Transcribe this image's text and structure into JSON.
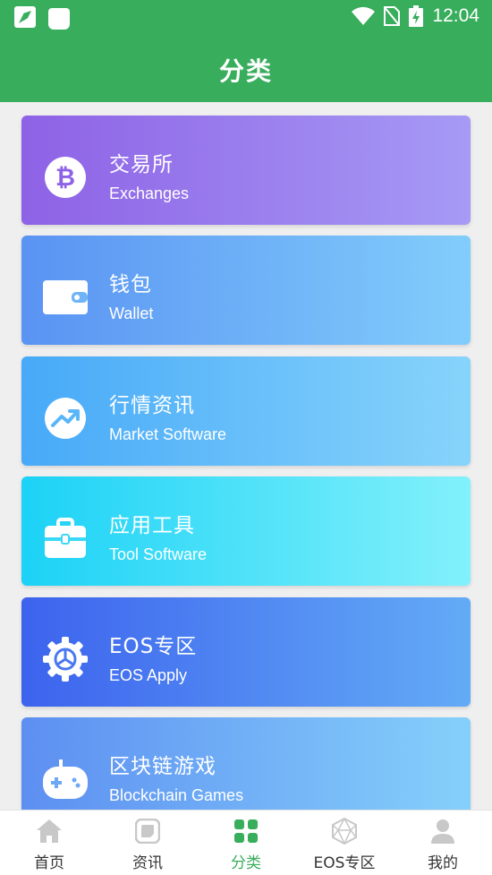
{
  "status_bar": {
    "time": "12:04"
  },
  "header": {
    "title": "分类"
  },
  "categories": [
    {
      "zh": "交易所",
      "en": "Exchanges",
      "icon": "bitcoin-icon",
      "colors": [
        "#8e62e6",
        "#a69af5"
      ]
    },
    {
      "zh": "钱包",
      "en": "Wallet",
      "icon": "wallet-icon",
      "colors": [
        "#5a93f3",
        "#81cdfb"
      ]
    },
    {
      "zh": "行情资讯",
      "en": "Market Software",
      "icon": "trend-up-icon",
      "colors": [
        "#47a9f8",
        "#87d4fb"
      ]
    },
    {
      "zh": "应用工具",
      "en": "Tool Software",
      "icon": "toolbox-icon",
      "colors": [
        "#1cd2f6",
        "#82f1fb"
      ]
    },
    {
      "zh": "EOS专区",
      "en": "EOS Apply",
      "icon": "eos-gear-icon",
      "colors": [
        "#3d63ee",
        "#63abf6"
      ]
    },
    {
      "zh": "区块链游戏",
      "en": "Blockchain Games",
      "icon": "gamepad-icon",
      "colors": [
        "#5d8ff1",
        "#85d0fb"
      ]
    }
  ],
  "tabs": [
    {
      "label": "首页",
      "icon": "home-icon",
      "active": false
    },
    {
      "label": "资讯",
      "icon": "news-icon",
      "active": false
    },
    {
      "label": "分类",
      "icon": "category-icon",
      "active": true
    },
    {
      "label": "EOS专区",
      "icon": "eos-icon",
      "active": false
    },
    {
      "label": "我的",
      "icon": "profile-icon",
      "active": false
    }
  ],
  "colors": {
    "brand": "#38ad5c",
    "tab_inactive": "#333333",
    "tab_icon_inactive": "#c8c8c8"
  }
}
